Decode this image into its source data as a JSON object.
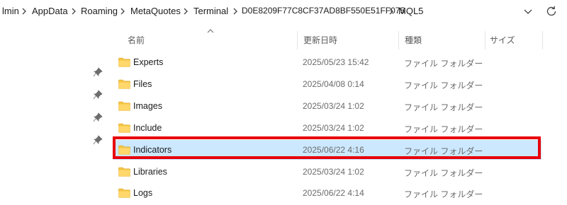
{
  "breadcrumb": {
    "items": [
      "lmin",
      "AppData",
      "Roaming",
      "MetaQuotes",
      "Terminal",
      "D0E8209F77C8CF37AD8BF550E51FF075",
      "MQL5"
    ]
  },
  "columns": {
    "name": "名前",
    "date": "更新日時",
    "type": "種類",
    "size": "サイズ"
  },
  "rows": [
    {
      "name": "Experts",
      "date": "2025/05/23 15:42",
      "type": "ファイル フォルダー"
    },
    {
      "name": "Files",
      "date": "2025/04/08 0:14",
      "type": "ファイル フォルダー"
    },
    {
      "name": "Images",
      "date": "2025/03/24 1:02",
      "type": "ファイル フォルダー"
    },
    {
      "name": "Include",
      "date": "2025/03/24 1:02",
      "type": "ファイル フォルダー"
    },
    {
      "name": "Indicators",
      "date": "2025/06/22 4:16",
      "type": "ファイル フォルダー",
      "selected": true
    },
    {
      "name": "Libraries",
      "date": "2025/03/24 1:02",
      "type": "ファイル フォルダー"
    },
    {
      "name": "Logs",
      "date": "2025/06/22 4:14",
      "type": "ファイル フォルダー"
    }
  ],
  "colors": {
    "selection": "#cce8ff",
    "highlight": "#e8000a",
    "folder": "#f4c542"
  }
}
